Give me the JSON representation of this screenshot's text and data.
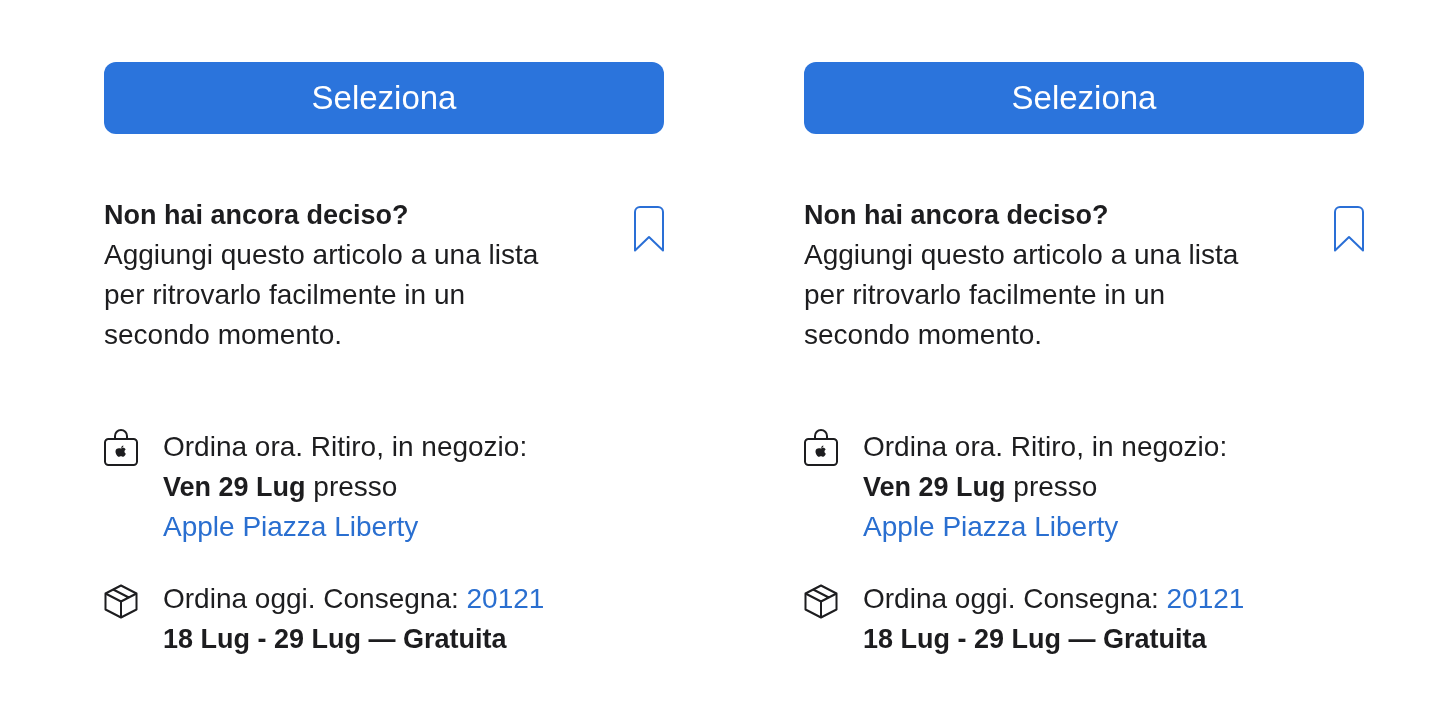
{
  "columns": [
    {
      "select_button": "Seleziona",
      "save_prompt": {
        "title": "Non hai ancora deciso?",
        "text": "Aggiungi questo articolo a una lista per ritrovarlo facilmente in un secondo momento."
      },
      "pickup": {
        "line_1": "Ordina ora. Ritiro, in negozio:",
        "line_2": "**Ven 29 Lug** presso",
        "store_link": "Apple Piazza Liberty"
      },
      "delivery": {
        "line_1": "Ordina oggi. Consegna:",
        "postcode_link": "20121",
        "dates": "18 Lug - 29 Lug — Gratuita"
      }
    },
    {
      "select_button": "Seleziona",
      "save_prompt": {
        "title": "Non hai ancora deciso?",
        "text": "Aggiungi questo articolo a una lista per ritrovarlo facilmente in un secondo momento."
      },
      "pickup": {
        "line_1": "Ordina ora. Ritiro, in negozio:",
        "line_2": "**Ven 29 Lug** presso",
        "store_link": "Apple Piazza Liberty"
      },
      "delivery": {
        "line_1": "Ordina oggi. Consegna:",
        "postcode_link": "20121",
        "dates": "18 Lug - 29 Lug — Gratuita"
      }
    }
  ]
}
